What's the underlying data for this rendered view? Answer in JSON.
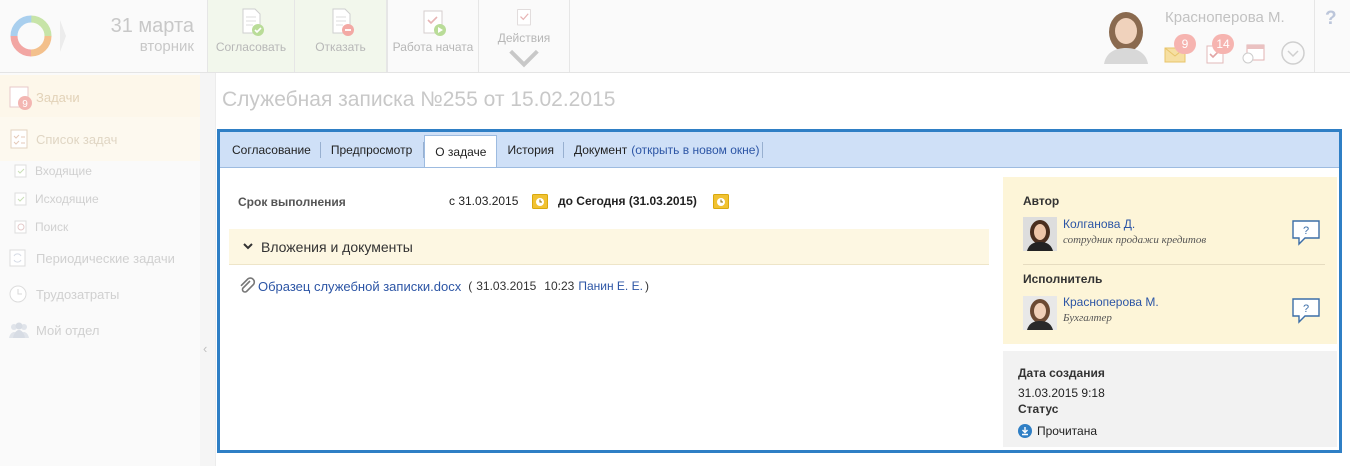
{
  "header": {
    "date_day": "31 марта",
    "date_weekday": "вторник",
    "toolbar": [
      {
        "label": "Согласовать"
      },
      {
        "label": "Отказать"
      },
      {
        "label": "Работа начата"
      },
      {
        "label": "Действия"
      }
    ],
    "user_name": "Красноперова М.",
    "badges": {
      "messages": "9",
      "tasks": "14"
    }
  },
  "sidebar": {
    "tasks_badge": "9",
    "items": [
      {
        "label": "Задачи"
      },
      {
        "label": "Список задач"
      },
      {
        "label": "Входящие"
      },
      {
        "label": "Исходящие"
      },
      {
        "label": "Поиск"
      },
      {
        "label": "Периодические задачи"
      },
      {
        "label": "Трудозатраты"
      },
      {
        "label": "Мой отдел"
      }
    ]
  },
  "page": {
    "title": "Служебная записка №255 от 15.02.2015"
  },
  "tabs": [
    {
      "label": "Согласование"
    },
    {
      "label": "Предпросмотр"
    },
    {
      "label": "О задаче"
    },
    {
      "label": "История"
    },
    {
      "label": "Документ"
    }
  ],
  "tab_link": "(открыть в новом окне)",
  "deadline": {
    "label": "Срок выполнения",
    "from": "с 31.03.2015",
    "to": "до Сегодня (31.03.2015)"
  },
  "attachments": {
    "header": "Вложения и документы",
    "file": {
      "name": "Образец служебной записки.docx",
      "open_paren": "(",
      "date": "31.03.2015",
      "time": "10:23",
      "author": "Панин Е. Е.",
      "close_paren": ")"
    }
  },
  "roles": {
    "author": {
      "label": "Автор",
      "name": "Колганова Д.",
      "position": "сотрудник продажи кредитов"
    },
    "executor": {
      "label": "Исполнитель",
      "name": "Красноперова М.",
      "position": "Бухгалтер"
    }
  },
  "meta": {
    "created_label": "Дата создания",
    "created_value": "31.03.2015 9:18",
    "status_label": "Статус",
    "status_value": "Прочитана"
  },
  "colors": {
    "accent": "#2f7fc5",
    "tab_bar": "#cfe0f7",
    "link": "#2c55a5",
    "attach_bg": "#fdf7e2",
    "roles_bg": "#fdf5d8",
    "badge": "#f6b4b0"
  }
}
